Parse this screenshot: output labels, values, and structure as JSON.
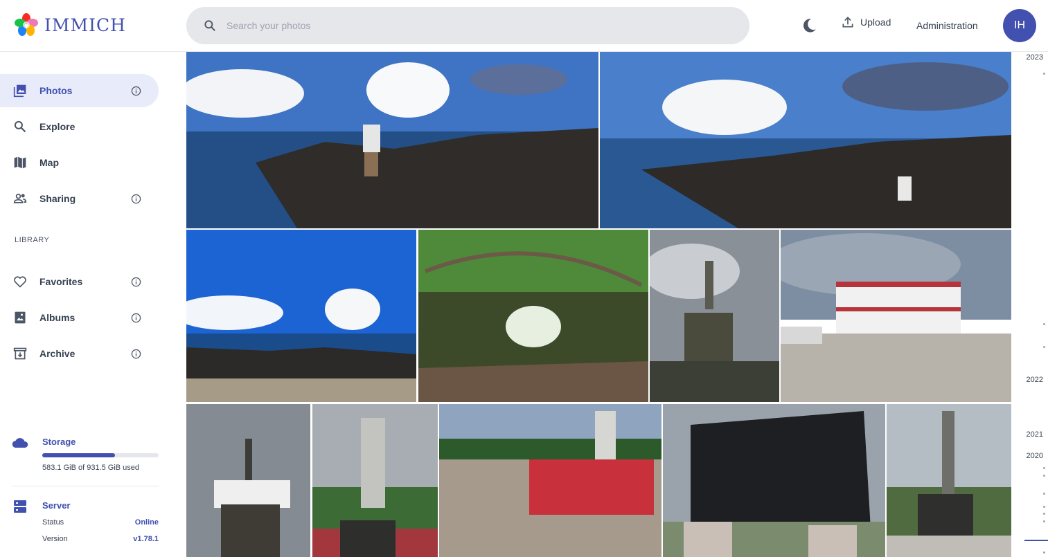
{
  "app": {
    "name": "IMMICH"
  },
  "search": {
    "placeholder": "Search your photos"
  },
  "header": {
    "upload_label": "Upload",
    "admin_label": "Administration",
    "avatar_initials": "IH"
  },
  "sidebar": {
    "items": [
      {
        "label": "Photos",
        "icon": "photos-icon",
        "active": true
      },
      {
        "label": "Explore",
        "icon": "search-icon"
      },
      {
        "label": "Map",
        "icon": "map-icon"
      },
      {
        "label": "Sharing",
        "icon": "sharing-icon"
      }
    ],
    "library_title": "LIBRARY",
    "library_items": [
      {
        "label": "Favorites",
        "icon": "heart-icon"
      },
      {
        "label": "Albums",
        "icon": "albums-icon"
      },
      {
        "label": "Archive",
        "icon": "archive-icon"
      }
    ]
  },
  "storage": {
    "title": "Storage",
    "used_text": "583.1 GiB of 931.5 GiB used",
    "used_fraction": 0.626
  },
  "server": {
    "title": "Server",
    "status_label": "Status",
    "status_value": "Online",
    "version_label": "Version",
    "version_value": "v1.78.1"
  },
  "timeline": {
    "years": [
      "2023",
      "2022",
      "2021",
      "2020"
    ]
  },
  "colors": {
    "accent": "#4250af",
    "active_bg": "#e8ebf9"
  }
}
